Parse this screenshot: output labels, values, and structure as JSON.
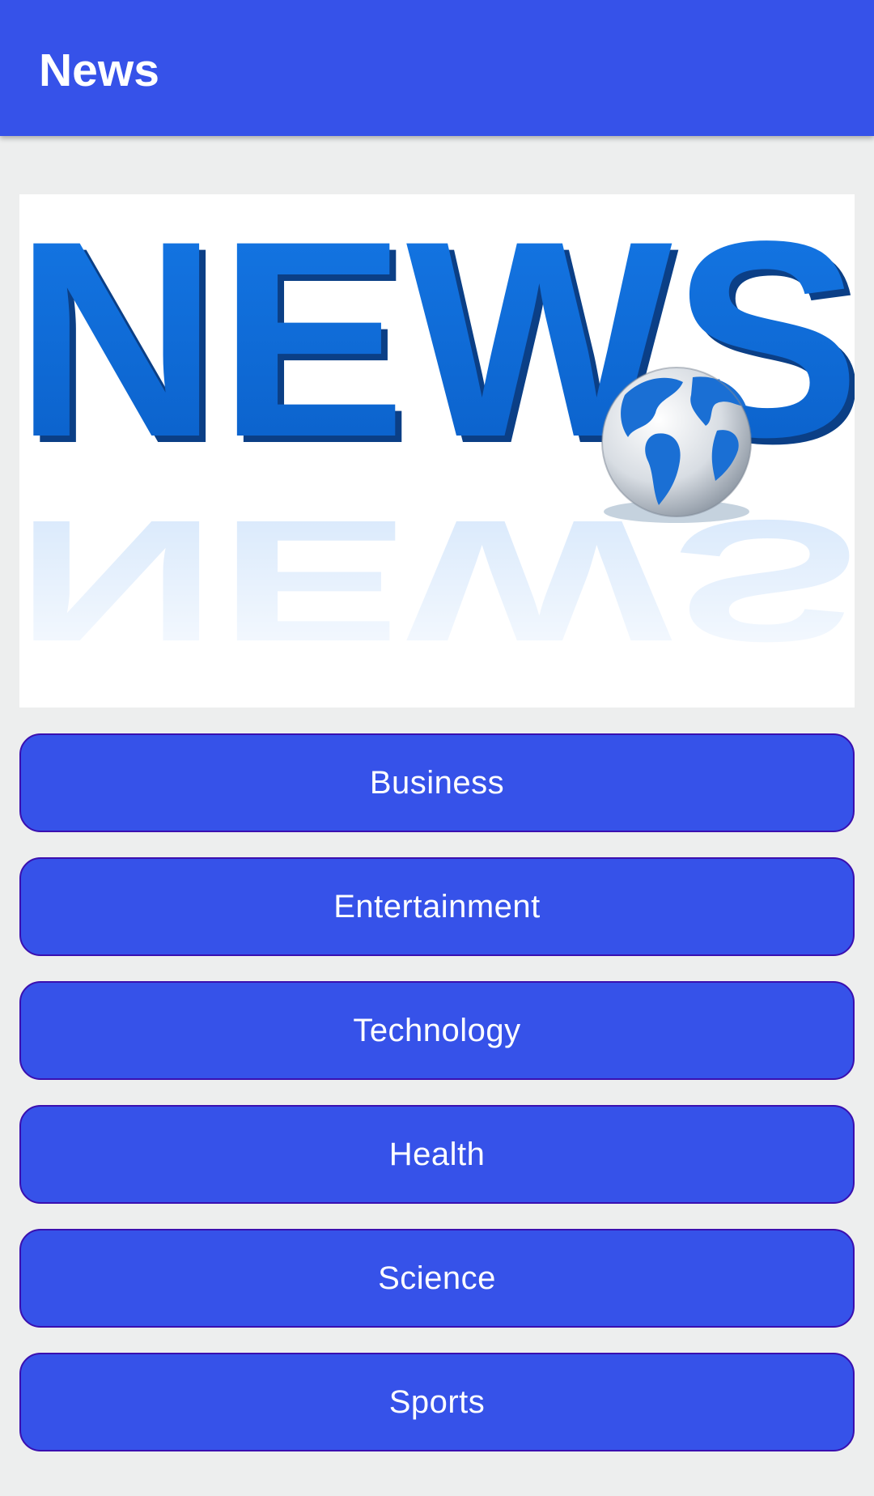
{
  "app_bar": {
    "title": "News",
    "color": "#3652e9"
  },
  "banner": {
    "word": "NEWS",
    "image": "news-globe-banner"
  },
  "categories": [
    {
      "label": "Business"
    },
    {
      "label": "Entertainment"
    },
    {
      "label": "Technology"
    },
    {
      "label": "Health"
    },
    {
      "label": "Science"
    },
    {
      "label": "Sports"
    }
  ],
  "colors": {
    "button": "#3652e9",
    "button_border": "#3a0fb0",
    "background": "#edeeee"
  }
}
